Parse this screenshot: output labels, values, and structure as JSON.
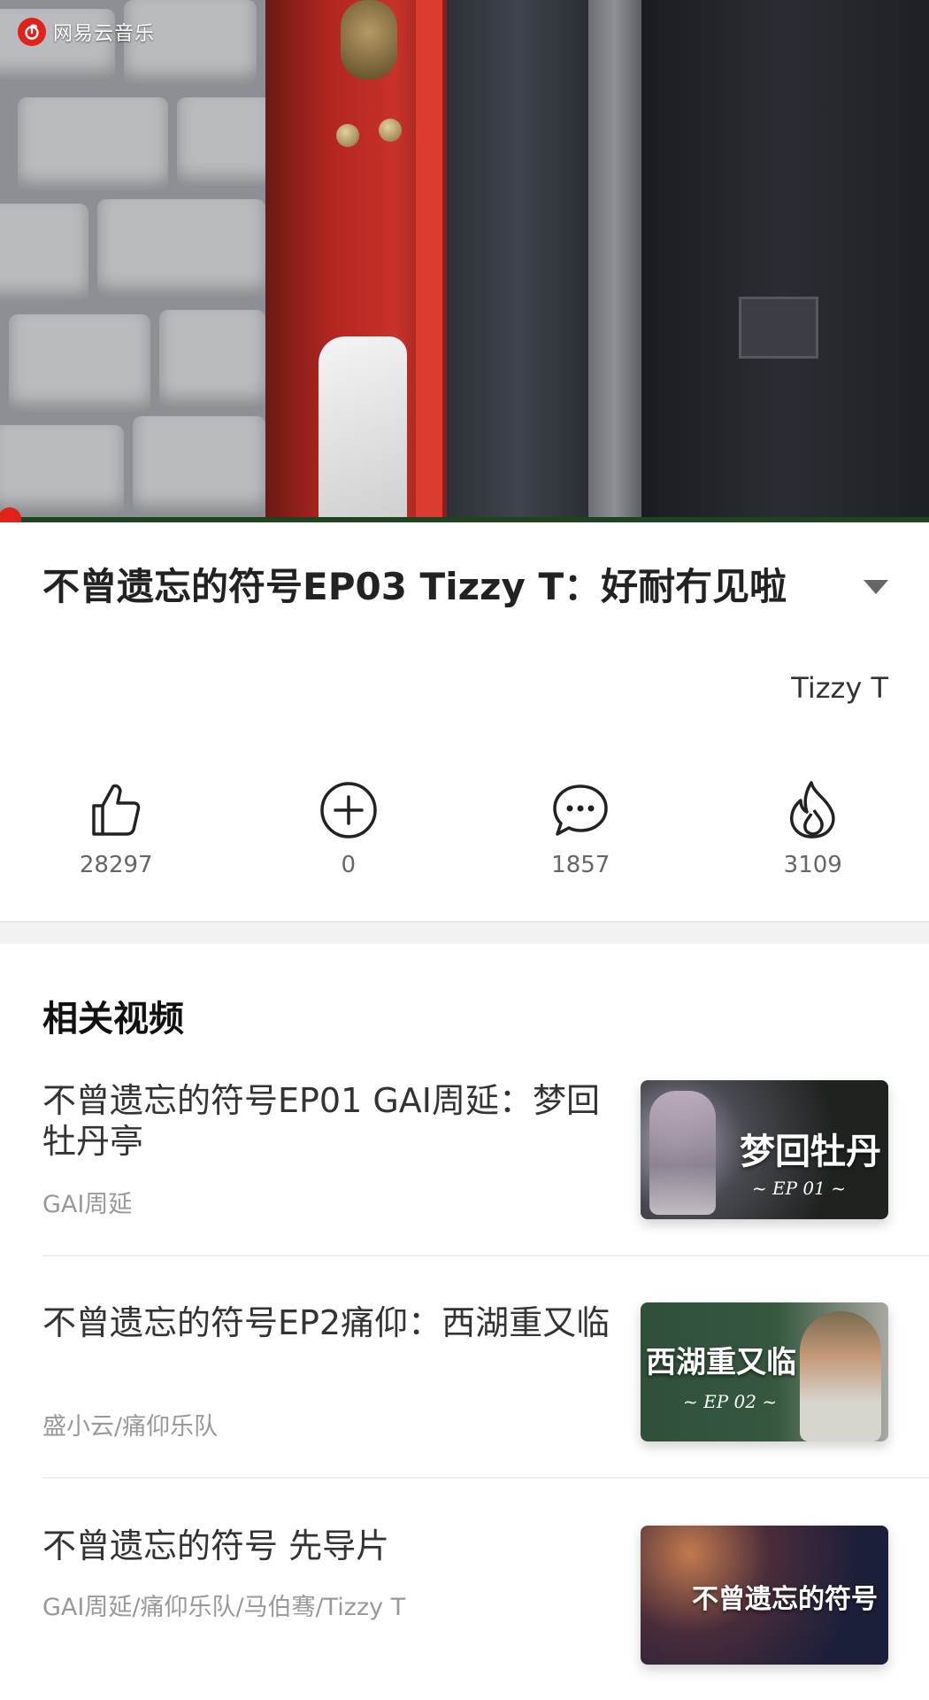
{
  "app": {
    "logo_text": "网易云音乐"
  },
  "player": {
    "progress": 0.004
  },
  "video": {
    "title": "不曾遗忘的符号EP03 Tizzy T：好耐冇见啦",
    "artist": "Tizzy T"
  },
  "actions": {
    "like_count": "28297",
    "add_count": "0",
    "comment_count": "1857",
    "share_count": "3109"
  },
  "related": {
    "heading": "相关视频",
    "items": [
      {
        "title": "不曾遗忘的符号EP01 GAI周延：梦回牡丹亭",
        "artists": "GAI周延",
        "thumb_caption": "梦回牡丹",
        "thumb_ep": "~ EP 01 ~"
      },
      {
        "title": "不曾遗忘的符号EP2痛仰：西湖重又临",
        "artists": "盛小云/痛仰乐队",
        "thumb_caption": "西湖重又临",
        "thumb_ep": "~ EP 02 ~"
      },
      {
        "title": "不曾遗忘的符号 先导片",
        "artists": "GAI周延/痛仰乐队/马伯骞/Tizzy T",
        "thumb_caption": "不曾遗忘的符号",
        "thumb_ep": ""
      }
    ]
  },
  "colors": {
    "accent": "#e0221b"
  }
}
